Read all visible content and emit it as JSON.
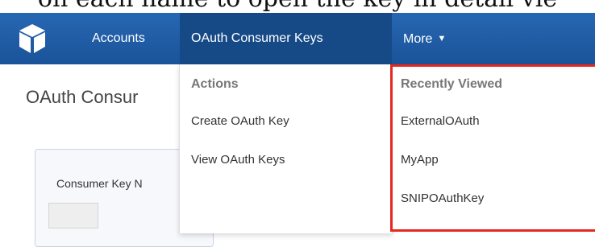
{
  "caption": "on each name to open the key in detail vie",
  "navbar": {
    "logo_icon": "cube-icon",
    "items": [
      {
        "label": "Accounts"
      },
      {
        "label": "OAuth Consumer Keys",
        "active": true
      },
      {
        "label": "More"
      }
    ],
    "more_caret_icon": "caret-down-icon",
    "colors": {
      "background": "#1e5ea8",
      "active": "#164a87",
      "highlight_border": "#e5281e"
    }
  },
  "page": {
    "title": "OAuth Consur",
    "table_header": "Consumer Key N"
  },
  "actions_menu": {
    "heading": "Actions",
    "items": [
      {
        "label": "Create OAuth Key"
      },
      {
        "label": "View OAuth Keys"
      }
    ]
  },
  "recent_menu": {
    "heading": "Recently Viewed",
    "items": [
      {
        "label": "ExternalOAuth"
      },
      {
        "label": "MyApp"
      },
      {
        "label": "SNIPOAuthKey"
      }
    ]
  }
}
